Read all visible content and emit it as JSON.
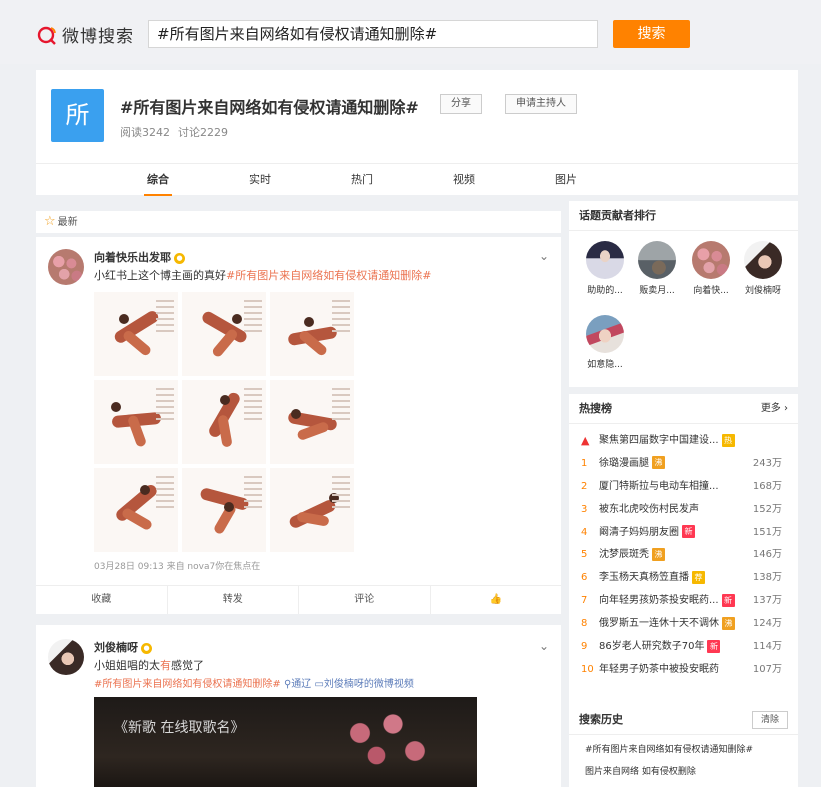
{
  "logo": {
    "text": "微博搜索",
    "icon": "weibo-search-logo-icon"
  },
  "search": {
    "value": "#所有图片来自网络如有侵权请通知删除#",
    "button": "搜索"
  },
  "topic": {
    "avatar_char": "所",
    "title": "#所有图片来自网络如有侵权请通知删除#",
    "share": "分享",
    "apply_host": "申请主持人",
    "reads": "阅读3242",
    "discussions": "讨论2229"
  },
  "tabs": [
    "综合",
    "实时",
    "热门",
    "视频",
    "图片"
  ],
  "feed": {
    "latest_label": "最新",
    "posts": [
      {
        "user": "向着快乐出发耶",
        "text_plain": "小红书上这个博主画的真好",
        "text_tag": "#所有图片来自网络如有侵权请通知删除#",
        "meta": "03月28日 09:13  来自 nova7你在焦点在",
        "actions": [
          "收藏",
          "转发",
          "评论",
          "👍"
        ]
      },
      {
        "user": "刘俊楠呀",
        "text_plain_a": "小姐姐唱的太",
        "text_highlight": "有",
        "text_plain_b": "感觉了",
        "tag_line_tag": "#所有图片来自网络如有侵权请通知删除#",
        "tag_line_loc": "⚲通辽",
        "tag_line_video": "▭刘俊楠呀的微博视频",
        "video_title": "《新歌 在线取歌名》"
      }
    ]
  },
  "contributors": {
    "title": "话题贡献者排行",
    "items": [
      "助助的...",
      "贩卖月...",
      "向着快...",
      "刘俊楠呀",
      "如意隐..."
    ]
  },
  "hot_search": {
    "title": "热搜榜",
    "more": "更多 ›",
    "rows": [
      {
        "rank": "▲",
        "title": "聚焦第四届数字中国建设...",
        "badge": "热",
        "badge_color": "#f6b800",
        "count": ""
      },
      {
        "rank": "1",
        "title": "徐璐漫画腿",
        "badge": "沸",
        "badge_color": "#f0a020",
        "count": "243万"
      },
      {
        "rank": "2",
        "title": "厦门特斯拉与电动车相撞...",
        "badge": "",
        "badge_color": "",
        "count": "168万"
      },
      {
        "rank": "3",
        "title": "被东北虎咬伤村民发声",
        "badge": "",
        "badge_color": "",
        "count": "152万"
      },
      {
        "rank": "4",
        "title": "阚清子妈妈朋友圈",
        "badge": "新",
        "badge_color": "#ff3852",
        "count": "151万"
      },
      {
        "rank": "5",
        "title": "沈梦辰斑秃",
        "badge": "沸",
        "badge_color": "#f0a020",
        "count": "146万"
      },
      {
        "rank": "6",
        "title": "李玉杨天真杨笠直播",
        "badge": "荐",
        "badge_color": "#f6b800",
        "count": "138万"
      },
      {
        "rank": "7",
        "title": "向年轻男孩奶茶投安眠药...",
        "badge": "新",
        "badge_color": "#ff3852",
        "count": "137万"
      },
      {
        "rank": "8",
        "title": "俄罗斯五一连休十天不调休",
        "badge": "沸",
        "badge_color": "#f0a020",
        "count": "124万"
      },
      {
        "rank": "9",
        "title": "86岁老人研究数子70年",
        "badge": "新",
        "badge_color": "#ff3852",
        "count": "114万"
      },
      {
        "rank": "10",
        "title": "年轻男子奶茶中被投安眠药",
        "badge": "",
        "badge_color": "",
        "count": "107万"
      }
    ]
  },
  "history": {
    "title": "搜索历史",
    "clear": "清除",
    "items": [
      "#所有图片来自网络如有侵权请通知删除#",
      "图片来自网络 如有侵权删除"
    ]
  },
  "colors": {
    "accent": "#ff8200",
    "tag": "#eb7350",
    "link": "#5d7dba"
  }
}
